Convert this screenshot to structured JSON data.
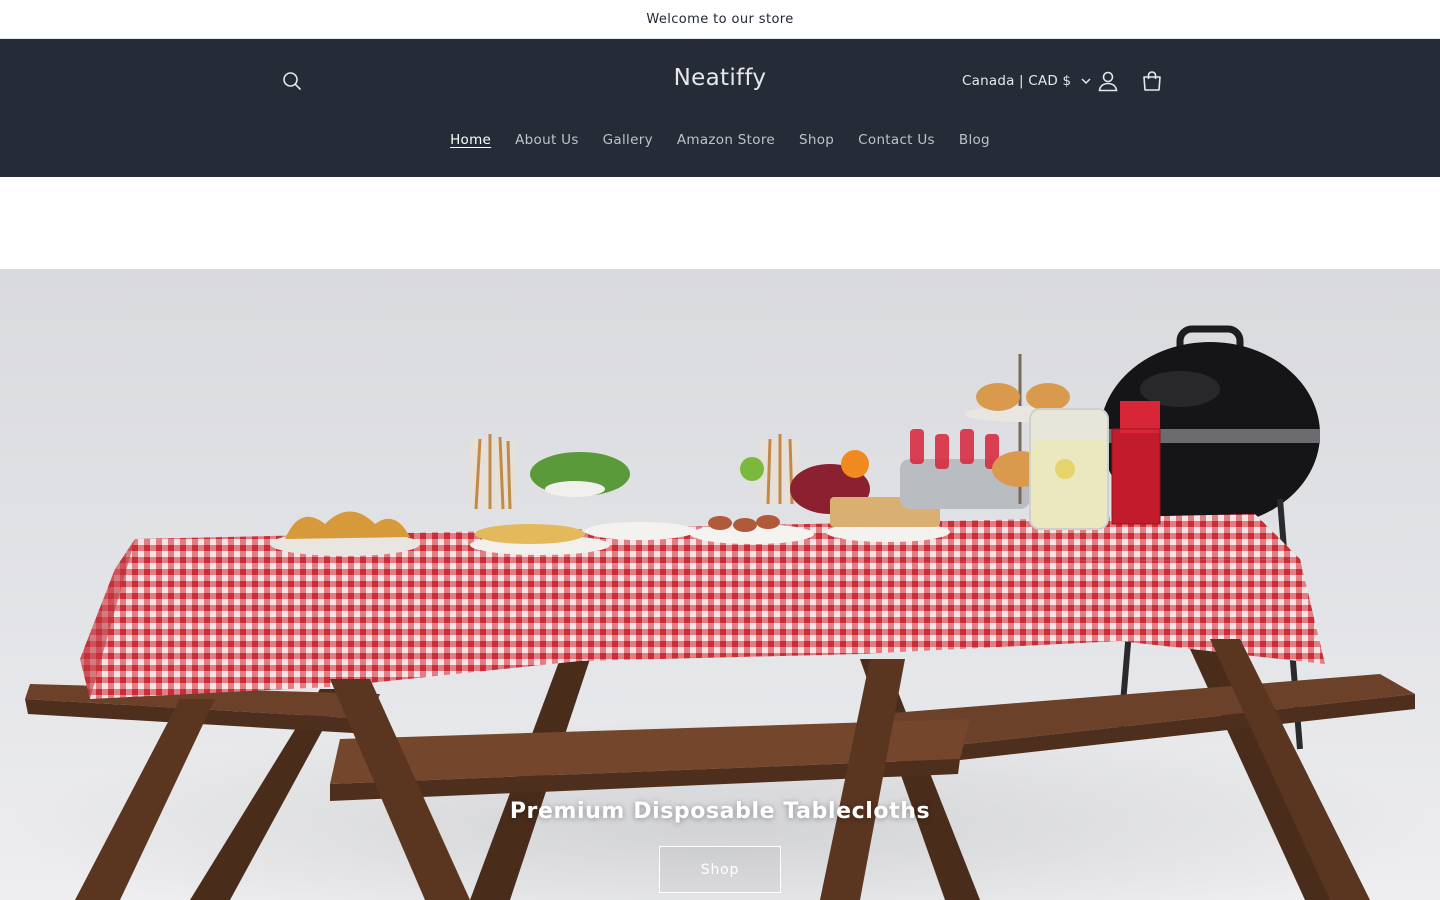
{
  "announcement": {
    "text": "Welcome to our store"
  },
  "header": {
    "logo": "Neatiffy",
    "country_selector": "Canada | CAD $",
    "icons": {
      "search": "search-icon",
      "account": "account-icon",
      "cart": "cart-icon",
      "dropdown": "chevron-down-icon"
    }
  },
  "nav": {
    "items": [
      {
        "label": "Home",
        "active": true
      },
      {
        "label": "About Us"
      },
      {
        "label": "Gallery"
      },
      {
        "label": "Amazon Store"
      },
      {
        "label": "Shop"
      },
      {
        "label": "Contact Us"
      },
      {
        "label": "Blog"
      }
    ]
  },
  "hero": {
    "title": "Premium Disposable Tablecloths",
    "button_label": "Shop"
  },
  "colors": {
    "header_bg": "#252b37",
    "page_bg": "#ffffff",
    "tablecloth_red": "#d43a43",
    "wood": "#5c3a24"
  }
}
